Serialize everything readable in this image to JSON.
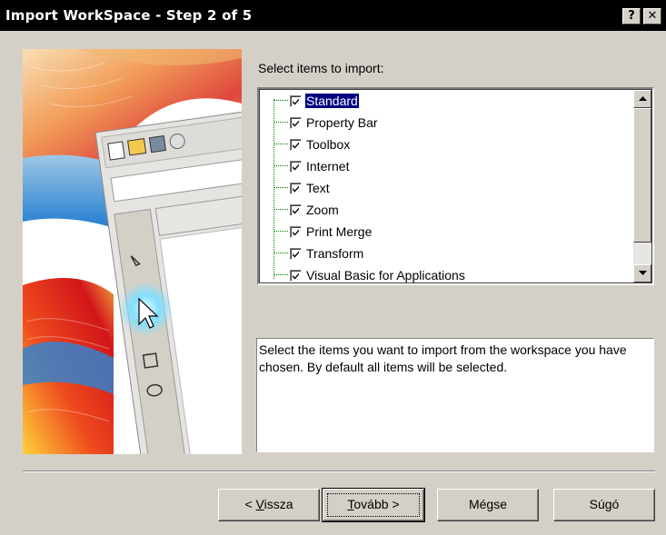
{
  "window": {
    "title": "Import WorkSpace - Step 2 of 5",
    "help_glyph": "?",
    "close_glyph": "✕"
  },
  "items_label": "Select items to import:",
  "items": [
    {
      "label": "Standard",
      "checked": true,
      "focused": true
    },
    {
      "label": "Property Bar",
      "checked": true
    },
    {
      "label": "Toolbox",
      "checked": true
    },
    {
      "label": "Internet",
      "checked": true
    },
    {
      "label": "Text",
      "checked": true
    },
    {
      "label": "Zoom",
      "checked": true
    },
    {
      "label": "Print Merge",
      "checked": true
    },
    {
      "label": "Transform",
      "checked": true
    },
    {
      "label": "Visual Basic for Applications",
      "checked": true
    }
  ],
  "description": "Select the items you want to import from the workspace you have chosen. By default all items will be selected.",
  "buttons": {
    "back_prefix": "< ",
    "back_mnemonic": "V",
    "back_rest": "issza",
    "next_mnemonic": "T",
    "next_rest": "ovább >",
    "cancel": "Mégse",
    "help": "Súgó"
  },
  "colors": {
    "titlebar": "#000000",
    "dialog_face": "#d4d0c8",
    "selection": "#000080",
    "tree_lines": "#008000"
  },
  "icons": {
    "help": "help-icon",
    "close": "close-icon",
    "checkbox": "check-icon",
    "scroll_up": "arrow-up-icon",
    "scroll_down": "arrow-down-icon"
  }
}
